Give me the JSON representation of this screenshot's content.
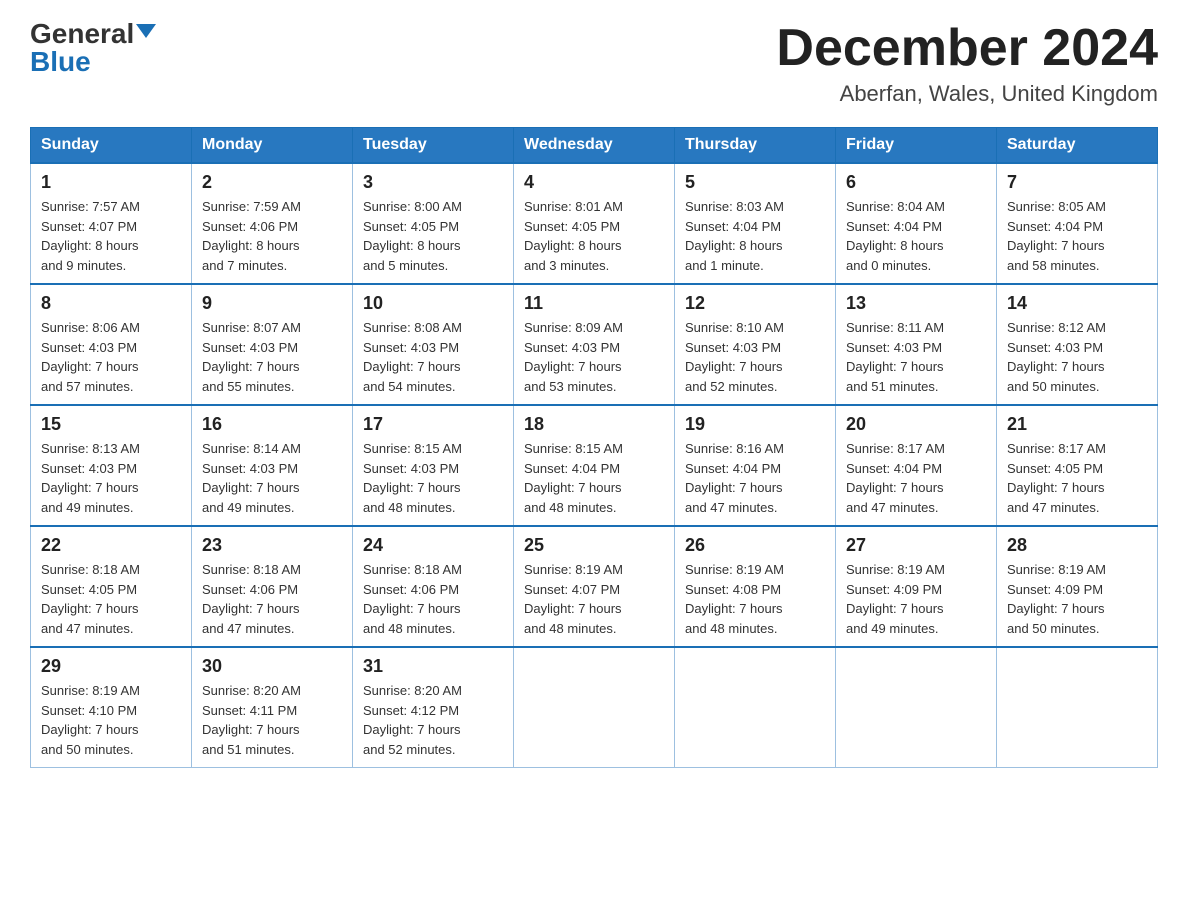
{
  "logo": {
    "general": "General",
    "blue": "Blue"
  },
  "title": {
    "month": "December 2024",
    "location": "Aberfan, Wales, United Kingdom"
  },
  "weekdays": [
    "Sunday",
    "Monday",
    "Tuesday",
    "Wednesday",
    "Thursday",
    "Friday",
    "Saturday"
  ],
  "weeks": [
    [
      {
        "day": "1",
        "info": "Sunrise: 7:57 AM\nSunset: 4:07 PM\nDaylight: 8 hours\nand 9 minutes."
      },
      {
        "day": "2",
        "info": "Sunrise: 7:59 AM\nSunset: 4:06 PM\nDaylight: 8 hours\nand 7 minutes."
      },
      {
        "day": "3",
        "info": "Sunrise: 8:00 AM\nSunset: 4:05 PM\nDaylight: 8 hours\nand 5 minutes."
      },
      {
        "day": "4",
        "info": "Sunrise: 8:01 AM\nSunset: 4:05 PM\nDaylight: 8 hours\nand 3 minutes."
      },
      {
        "day": "5",
        "info": "Sunrise: 8:03 AM\nSunset: 4:04 PM\nDaylight: 8 hours\nand 1 minute."
      },
      {
        "day": "6",
        "info": "Sunrise: 8:04 AM\nSunset: 4:04 PM\nDaylight: 8 hours\nand 0 minutes."
      },
      {
        "day": "7",
        "info": "Sunrise: 8:05 AM\nSunset: 4:04 PM\nDaylight: 7 hours\nand 58 minutes."
      }
    ],
    [
      {
        "day": "8",
        "info": "Sunrise: 8:06 AM\nSunset: 4:03 PM\nDaylight: 7 hours\nand 57 minutes."
      },
      {
        "day": "9",
        "info": "Sunrise: 8:07 AM\nSunset: 4:03 PM\nDaylight: 7 hours\nand 55 minutes."
      },
      {
        "day": "10",
        "info": "Sunrise: 8:08 AM\nSunset: 4:03 PM\nDaylight: 7 hours\nand 54 minutes."
      },
      {
        "day": "11",
        "info": "Sunrise: 8:09 AM\nSunset: 4:03 PM\nDaylight: 7 hours\nand 53 minutes."
      },
      {
        "day": "12",
        "info": "Sunrise: 8:10 AM\nSunset: 4:03 PM\nDaylight: 7 hours\nand 52 minutes."
      },
      {
        "day": "13",
        "info": "Sunrise: 8:11 AM\nSunset: 4:03 PM\nDaylight: 7 hours\nand 51 minutes."
      },
      {
        "day": "14",
        "info": "Sunrise: 8:12 AM\nSunset: 4:03 PM\nDaylight: 7 hours\nand 50 minutes."
      }
    ],
    [
      {
        "day": "15",
        "info": "Sunrise: 8:13 AM\nSunset: 4:03 PM\nDaylight: 7 hours\nand 49 minutes."
      },
      {
        "day": "16",
        "info": "Sunrise: 8:14 AM\nSunset: 4:03 PM\nDaylight: 7 hours\nand 49 minutes."
      },
      {
        "day": "17",
        "info": "Sunrise: 8:15 AM\nSunset: 4:03 PM\nDaylight: 7 hours\nand 48 minutes."
      },
      {
        "day": "18",
        "info": "Sunrise: 8:15 AM\nSunset: 4:04 PM\nDaylight: 7 hours\nand 48 minutes."
      },
      {
        "day": "19",
        "info": "Sunrise: 8:16 AM\nSunset: 4:04 PM\nDaylight: 7 hours\nand 47 minutes."
      },
      {
        "day": "20",
        "info": "Sunrise: 8:17 AM\nSunset: 4:04 PM\nDaylight: 7 hours\nand 47 minutes."
      },
      {
        "day": "21",
        "info": "Sunrise: 8:17 AM\nSunset: 4:05 PM\nDaylight: 7 hours\nand 47 minutes."
      }
    ],
    [
      {
        "day": "22",
        "info": "Sunrise: 8:18 AM\nSunset: 4:05 PM\nDaylight: 7 hours\nand 47 minutes."
      },
      {
        "day": "23",
        "info": "Sunrise: 8:18 AM\nSunset: 4:06 PM\nDaylight: 7 hours\nand 47 minutes."
      },
      {
        "day": "24",
        "info": "Sunrise: 8:18 AM\nSunset: 4:06 PM\nDaylight: 7 hours\nand 48 minutes."
      },
      {
        "day": "25",
        "info": "Sunrise: 8:19 AM\nSunset: 4:07 PM\nDaylight: 7 hours\nand 48 minutes."
      },
      {
        "day": "26",
        "info": "Sunrise: 8:19 AM\nSunset: 4:08 PM\nDaylight: 7 hours\nand 48 minutes."
      },
      {
        "day": "27",
        "info": "Sunrise: 8:19 AM\nSunset: 4:09 PM\nDaylight: 7 hours\nand 49 minutes."
      },
      {
        "day": "28",
        "info": "Sunrise: 8:19 AM\nSunset: 4:09 PM\nDaylight: 7 hours\nand 50 minutes."
      }
    ],
    [
      {
        "day": "29",
        "info": "Sunrise: 8:19 AM\nSunset: 4:10 PM\nDaylight: 7 hours\nand 50 minutes."
      },
      {
        "day": "30",
        "info": "Sunrise: 8:20 AM\nSunset: 4:11 PM\nDaylight: 7 hours\nand 51 minutes."
      },
      {
        "day": "31",
        "info": "Sunrise: 8:20 AM\nSunset: 4:12 PM\nDaylight: 7 hours\nand 52 minutes."
      },
      {
        "day": "",
        "info": ""
      },
      {
        "day": "",
        "info": ""
      },
      {
        "day": "",
        "info": ""
      },
      {
        "day": "",
        "info": ""
      }
    ]
  ]
}
